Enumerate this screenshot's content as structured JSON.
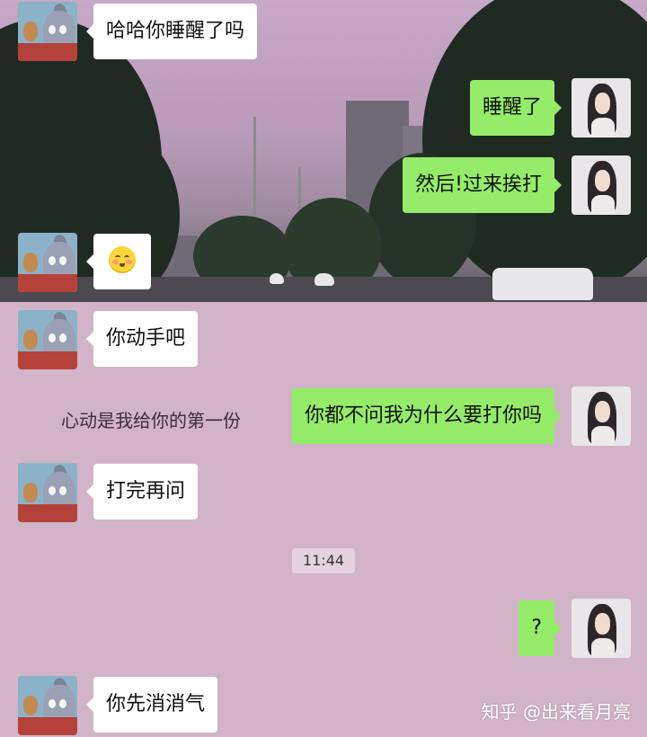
{
  "messages": [
    {
      "side": "in",
      "text": "哈哈你睡醒了吗"
    },
    {
      "side": "out",
      "text": "睡醒了"
    },
    {
      "side": "out",
      "text": "然后!过来挨打"
    },
    {
      "side": "in",
      "emoji": "blushing-face"
    },
    {
      "side": "in",
      "text": "你动手吧"
    },
    {
      "side": "out",
      "text": "你都不问我为什么要打你吗"
    },
    {
      "side": "in",
      "text": "打完再问"
    },
    {
      "side": "out",
      "text": "?"
    },
    {
      "side": "in",
      "text": "你先消消气"
    }
  ],
  "timestamp": "11:44",
  "background_text": "心动是我给你的第一份",
  "watermark": "知乎 @出来看月亮",
  "colors": {
    "outgoing_bubble": "#95ec69",
    "incoming_bubble": "#ffffff",
    "chat_background": "#d2b4c8"
  },
  "icons": {
    "contact_avatar": "tom-and-jerry-avatar",
    "self_avatar": "girl-portrait-avatar"
  }
}
